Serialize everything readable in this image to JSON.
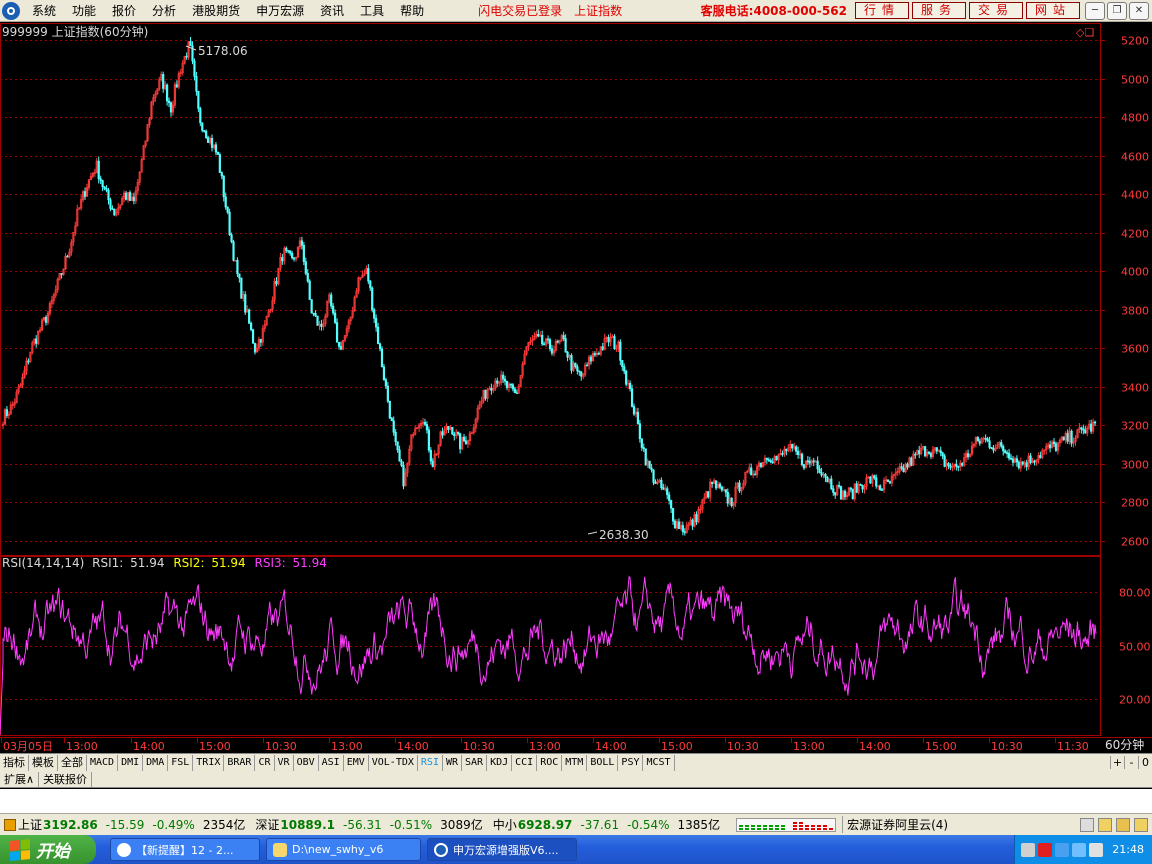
{
  "menu": {
    "items": [
      "系统",
      "功能",
      "报价",
      "分析",
      "港股期货",
      "申万宏源",
      "资讯",
      "工具",
      "帮助"
    ],
    "login_status": "闪电交易已登录",
    "current_index": "上证指数",
    "phone": "客服电话:4008-000-562",
    "buttons": [
      "行情",
      "服务",
      "交易",
      "网站"
    ]
  },
  "chart": {
    "title": "999999 上证指数(60分钟)",
    "high_label": "5178.06",
    "low_label": "2638.30",
    "colors": {
      "up": "#ff3c3c",
      "down": "#54ffff",
      "rsi": "#ff3cff",
      "grid": "#a00000",
      "axis": "#ff3c3c"
    },
    "rsi_header": {
      "name": "RSI(14,14,14)",
      "rsi1_label": "RSI1:",
      "rsi1": "51.94",
      "rsi2_label": "RSI2:",
      "rsi2": "51.94",
      "rsi3_label": "RSI3:",
      "rsi3": "51.94"
    },
    "period": "60分钟",
    "time_labels": [
      "03月05日",
      "13:00",
      "14:00",
      "15:00",
      "10:30",
      "13:00",
      "14:00",
      "10:30",
      "13:00",
      "14:00",
      "15:00",
      "10:30",
      "13:00",
      "14:00",
      "15:00",
      "10:30",
      "11:30"
    ]
  },
  "chart_data": [
    {
      "type": "candlestick",
      "title": "999999 上证指数(60分钟)",
      "ylim": [
        2550,
        5250
      ],
      "yticks": [
        2600,
        2800,
        3000,
        3200,
        3400,
        3600,
        3800,
        4000,
        4200,
        4400,
        4600,
        4800,
        5000,
        5200
      ],
      "annotations": [
        {
          "text": "5178.06",
          "value": 5178.06
        },
        {
          "text": "2638.30",
          "value": 2638.3
        }
      ],
      "close_path": [
        3240,
        3300,
        3420,
        3600,
        3700,
        3800,
        3950,
        4100,
        4300,
        4450,
        4550,
        4400,
        4300,
        4400,
        4350,
        4600,
        4900,
        5000,
        4850,
        5050,
        5178,
        4800,
        4700,
        4600,
        4300,
        4000,
        3800,
        3600,
        3700,
        3900,
        4100,
        4050,
        4150,
        3800,
        3700,
        3850,
        3600,
        3700,
        3950,
        4000,
        3700,
        3400,
        3100,
        2900,
        3200,
        3250,
        3000,
        3150,
        3200,
        3100,
        3150,
        3300,
        3400,
        3450,
        3400,
        3350,
        3600,
        3650,
        3620,
        3600,
        3640,
        3500,
        3450,
        3550,
        3600,
        3650,
        3600,
        3400,
        3200,
        3000,
        2900,
        2850,
        2700,
        2660,
        2700,
        2800,
        2900,
        2850,
        2800,
        2900,
        2950,
        3000,
        3050,
        3020,
        3080,
        3050,
        3000,
        3020,
        2950,
        2880,
        2840,
        2850,
        2900,
        2920,
        2880,
        2900,
        2950,
        3000,
        3050,
        3080,
        3060,
        3000,
        2980,
        3020,
        3100,
        3130,
        3100,
        3080,
        3050,
        3000,
        3020,
        3050,
        3080,
        3100,
        3130,
        3150,
        3180,
        3200
      ]
    },
    {
      "type": "line",
      "title": "RSI(14,14,14)",
      "series": [
        {
          "name": "RSI1",
          "values": []
        },
        {
          "name": "RSI2",
          "values": []
        },
        {
          "name": "RSI3",
          "values": []
        }
      ],
      "ylim": [
        0,
        100
      ],
      "yticks": [
        20,
        50,
        80
      ]
    }
  ],
  "tabs": {
    "row1": [
      "指标",
      "模板",
      "全部",
      "MACD",
      "DMI",
      "DMA",
      "FSL",
      "TRIX",
      "BRAR",
      "CR",
      "VR",
      "OBV",
      "ASI",
      "EMV",
      "VOL-TDX",
      "RSI",
      "WR",
      "SAR",
      "KDJ",
      "CCI",
      "ROC",
      "MTM",
      "BOLL",
      "PSY",
      "MCST"
    ],
    "active": "RSI",
    "right_controls": [
      "+",
      "-",
      "0"
    ],
    "row2": [
      "扩展∧",
      "关联报价"
    ]
  },
  "status": {
    "sh": {
      "name": "上证",
      "value": "3192.86",
      "change": "-15.59",
      "pct": "-0.49%",
      "amount": "2354亿"
    },
    "sz": {
      "name": "深证",
      "value": "10889.1",
      "change": "-56.31",
      "pct": "-0.51%",
      "amount": "3089亿"
    },
    "zx": {
      "name": "中小",
      "value": "6928.97",
      "change": "-37.61",
      "pct": "-0.54%",
      "amount": "1385亿"
    },
    "broker": "宏源证券阿里云(4)"
  },
  "taskbar": {
    "start": "开始",
    "tasks": [
      "【新提醒】12 - 2...",
      "D:\\new_swhy_v6",
      "申万宏源增强版V6...."
    ],
    "clock": "21:48"
  }
}
